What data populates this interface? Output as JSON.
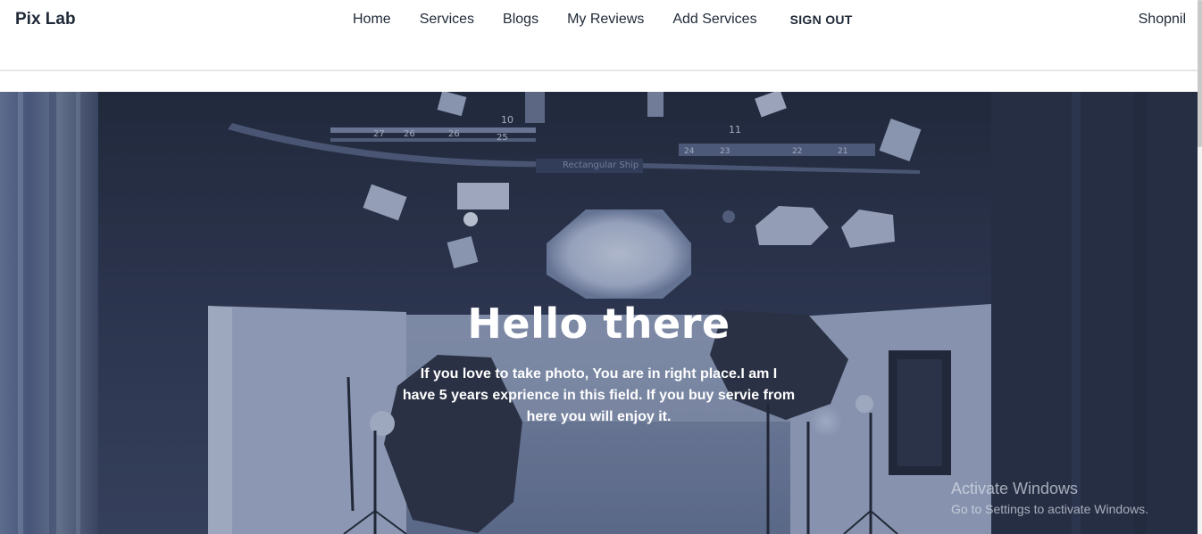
{
  "navbar": {
    "brand": "Pix Lab",
    "links": [
      "Home",
      "Services",
      "Blogs",
      "My Reviews",
      "Add Services"
    ],
    "signout": "SIGN OUT",
    "user": "Shopnil"
  },
  "hero": {
    "title": "Hello there",
    "text": "If you love to take photo, You are in right place.I am I have 5 years exprience in this field. If you buy servie from here you will enjoy it.",
    "bg_color": "#2c3346",
    "studio_labels": [
      "27",
      "26",
      "26",
      "25",
      "10",
      "11",
      "24",
      "23",
      "22",
      "21"
    ],
    "tooltip": "Rectangular Ship"
  },
  "os_watermark": {
    "title": "Activate Windows",
    "subtitle": "Go to Settings to activate Windows."
  }
}
